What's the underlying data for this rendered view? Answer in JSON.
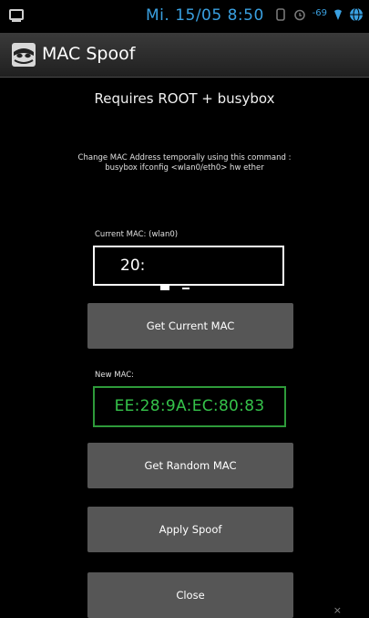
{
  "status_bar": {
    "time": "Mi. 15/05 8:50",
    "signal": "-69",
    "accent_color": "#3aa0e0",
    "icons": [
      "screen-icon",
      "sync-icon",
      "alarm-icon",
      "wifi-icon",
      "globe-icon"
    ]
  },
  "action_bar": {
    "title": "MAC Spoof",
    "icon": "app-mask-icon"
  },
  "main": {
    "heading": "Requires ROOT + busybox",
    "description_line1": "Change MAC Address temporally using this command :",
    "description_line2": "busybox ifconfig <wlan0/eth0> hw ether",
    "current_mac": {
      "label": "Current MAC: (wlan0)",
      "value": "20:"
    },
    "get_current_button": "Get Current MAC",
    "new_mac": {
      "label": "New MAC:",
      "value": "EE:28:9A:EC:80:83",
      "color": "#35c24a"
    },
    "get_random_button": "Get Random MAC",
    "apply_button": "Apply Spoof",
    "close_button": "Close"
  }
}
